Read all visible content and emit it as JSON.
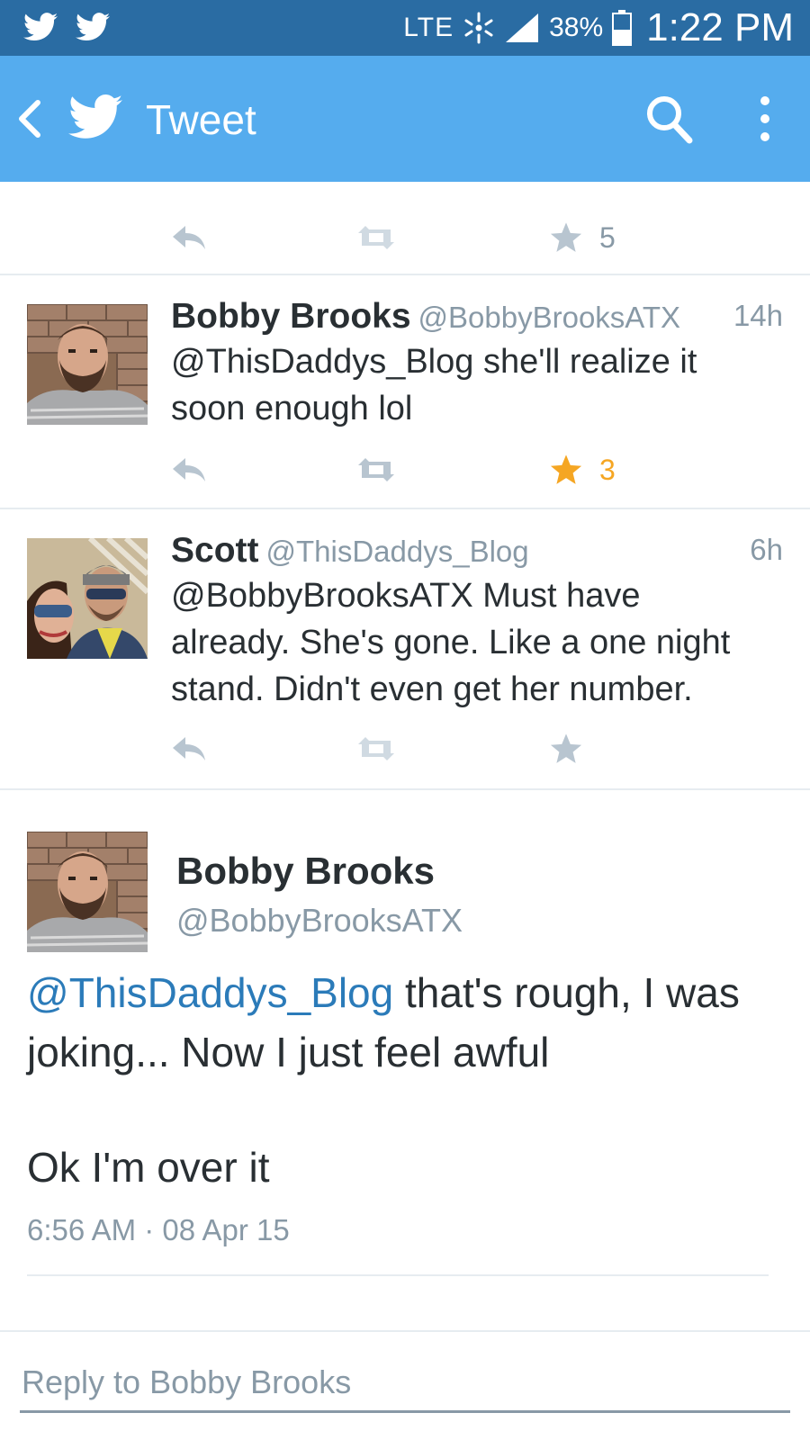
{
  "status_bar": {
    "network": "LTE",
    "battery": "38%",
    "time": "1:22 PM",
    "notification_icons": [
      "twitter-bird-icon",
      "twitter-bird-icon"
    ]
  },
  "app_bar": {
    "title": "Tweet",
    "background": "#55acee"
  },
  "top_actions": {
    "favorites": "5"
  },
  "tweets": [
    {
      "name": "Bobby Brooks",
      "handle": "@BobbyBrooksATX",
      "time": "14h",
      "text_lines": [
        "@ThisDaddys_Blog she'll realize it",
        "soon enough lol"
      ],
      "favorites": "3",
      "favorited": true
    },
    {
      "name": "Scott",
      "handle": "@ThisDaddys_Blog",
      "time": "6h",
      "text_lines": [
        "@BobbyBrooksATX Must have",
        "already. She's gone. Like a one night",
        "stand. Didn't even get her number."
      ],
      "favorites": "",
      "favorited": false
    }
  ],
  "focused_tweet": {
    "name": "Bobby Brooks",
    "handle": "@BobbyBrooksATX",
    "mention": "@ThisDaddys_Blog",
    "text_line1_rest": " that's rough, I was",
    "text_line2": "joking... Now I just feel awful",
    "text_line3": "Ok I'm over it",
    "timestamp": "6:56 AM · 08 Apr 15"
  },
  "reply": {
    "placeholder": "Reply to Bobby Brooks"
  },
  "colors": {
    "status_bar": "#2a6ca3",
    "accent": "#55acee",
    "mention": "#2b7bb9",
    "favorite_active": "#f5a623",
    "muted": "#8899a6"
  }
}
